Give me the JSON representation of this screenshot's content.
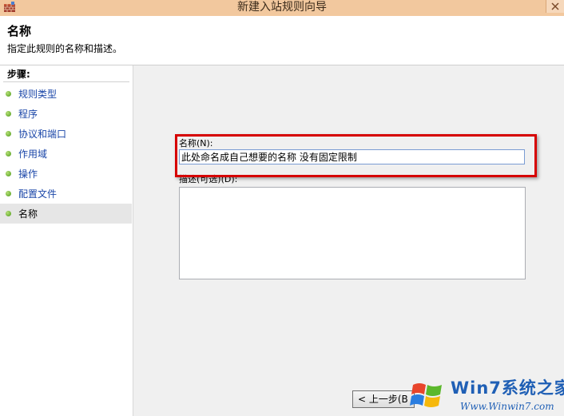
{
  "window": {
    "title": "新建入站规则向导",
    "icon": "firewall-icon",
    "close_icon": "close-icon"
  },
  "header": {
    "title": "名称",
    "description": "指定此规则的名称和描述。"
  },
  "steps": {
    "title": "步骤:",
    "items": [
      {
        "label": "规则类型",
        "active": false
      },
      {
        "label": "程序",
        "active": false
      },
      {
        "label": "协议和端口",
        "active": false
      },
      {
        "label": "作用域",
        "active": false
      },
      {
        "label": "操作",
        "active": false
      },
      {
        "label": "配置文件",
        "active": false
      },
      {
        "label": "名称",
        "active": true
      }
    ]
  },
  "form": {
    "name_label": "名称(N):",
    "name_value": "此处命名成自己想要的名称 没有固定限制",
    "description_label": "描述(可选)(D):",
    "description_value": ""
  },
  "buttons": {
    "back_label": "< 上一步(B"
  },
  "watermark": {
    "text": "Win7系统之家",
    "url": "Www.Winwin7.com"
  },
  "colors": {
    "highlight": "#d60000",
    "titlebar": "#f2c89e",
    "active_step_bg": "#e6e6e6",
    "link": "#1a46a8"
  }
}
